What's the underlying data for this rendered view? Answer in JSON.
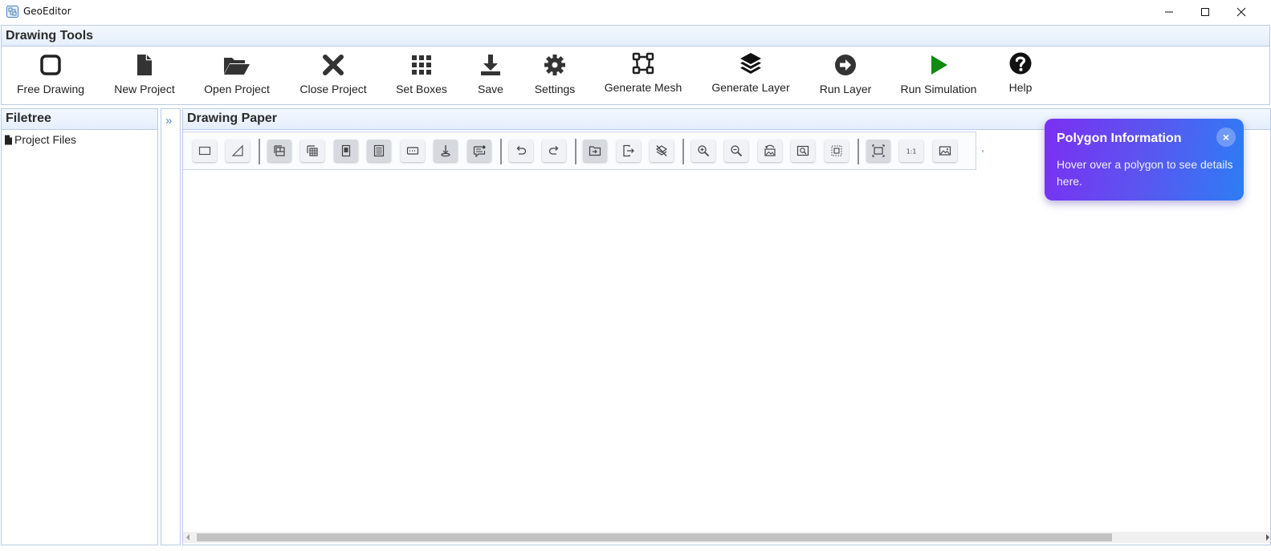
{
  "window": {
    "title": "GeoEditor",
    "controls": [
      "minimize-icon",
      "maximize-icon",
      "close-icon"
    ]
  },
  "tools_header": "Drawing Tools",
  "toolbar": [
    {
      "label": "Free Drawing",
      "icon": "square-outline-icon"
    },
    {
      "label": "New Project",
      "icon": "file-icon"
    },
    {
      "label": "Open Project",
      "icon": "folder-open-icon"
    },
    {
      "label": "Close Project",
      "icon": "x-icon"
    },
    {
      "label": "Set Boxes",
      "icon": "grid-icon"
    },
    {
      "label": "Save",
      "icon": "download-icon"
    },
    {
      "label": "Settings",
      "icon": "gear-icon"
    },
    {
      "label": "Generate Mesh",
      "icon": "vector-square-icon"
    },
    {
      "label": "Generate Layer",
      "icon": "layers-icon"
    },
    {
      "label": "Run Layer",
      "icon": "arrow-circle-right-icon"
    },
    {
      "label": "Run Simulation",
      "icon": "play-icon",
      "color": "#118a11"
    },
    {
      "label": "Help",
      "icon": "question-circle-icon"
    }
  ],
  "filetree": {
    "title": "Filetree",
    "items": [
      "Project Files"
    ]
  },
  "collapse_glyph": "»",
  "paper": {
    "title": "Drawing Paper"
  },
  "popup": {
    "title": "Polygon Information",
    "text": "Hover over a polygon to see details here.",
    "close": "×"
  },
  "colors": {
    "header_border": "#b9cbe3",
    "popup_gradient_start": "#7b2ff2",
    "popup_gradient_end": "#2d7df6",
    "run_simulation": "#118a11"
  }
}
